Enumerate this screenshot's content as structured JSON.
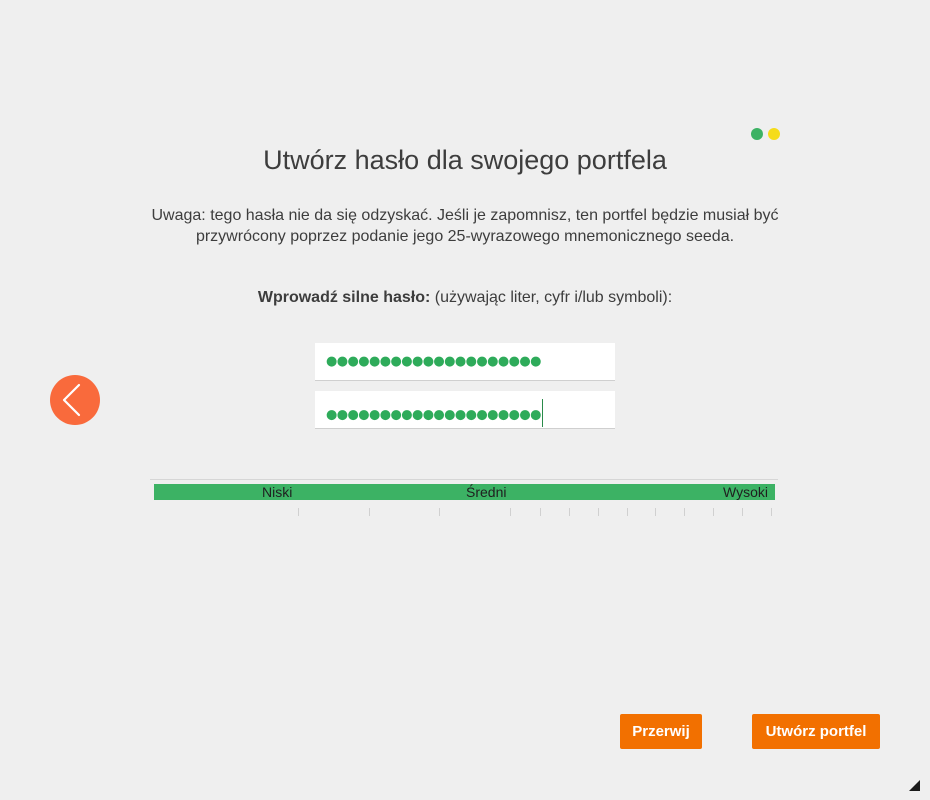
{
  "step_indicator": {
    "dots": [
      {
        "name": "step-1",
        "color": "#3cb264"
      },
      {
        "name": "step-2",
        "color": "#f5dc1a"
      }
    ]
  },
  "header": {
    "title": "Utwórz hasło dla swojego portfela"
  },
  "warning": {
    "text": "Uwaga: tego hasła nie da się odzyskać. Jeśli je zapomnisz, ten portfel będzie musiał być przywrócony poprzez podanie jego 25-wyrazowego mnemonicznego seeda."
  },
  "prompt": {
    "bold": "Wprowadź silne hasło:",
    "rest": " (używając liter, cyfr i/lub symboli):"
  },
  "back_button": {
    "icon": "chevron-left-icon",
    "color": "#f96a3c"
  },
  "password": {
    "masked": "●●●●●●●●●●●●●●●●●●●●",
    "length": 20
  },
  "password_confirm": {
    "masked": "●●●●●●●●●●●●●●●●●●●●",
    "length": 20
  },
  "strength_meter": {
    "labels": {
      "low": "Niski",
      "medium": "Średni",
      "high": "Wysoki"
    },
    "fill_fraction": 1.0,
    "color": "#3cb264"
  },
  "actions": {
    "cancel_label": "Przerwij",
    "create_label": "Utwórz portfel",
    "button_color": "#f27000"
  }
}
